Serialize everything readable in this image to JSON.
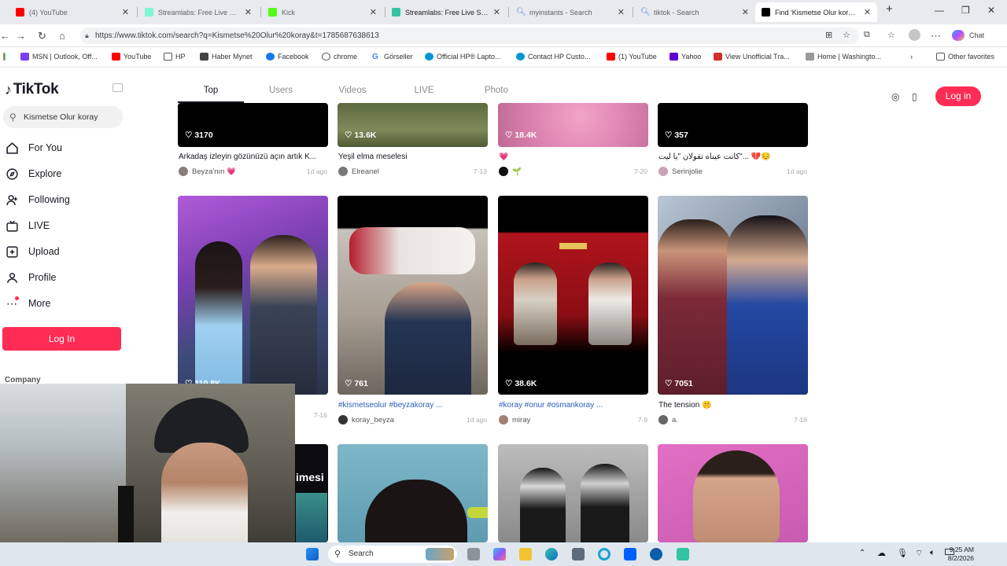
{
  "browser": {
    "tabs": [
      {
        "label": "(4) YouTube",
        "color": "#ff0000"
      },
      {
        "label": "Streamlabs: Free Live Stream",
        "color": "#80f5d2"
      },
      {
        "label": "Kick",
        "color": "#53fc18"
      },
      {
        "label": "Streamlabs: Free Live Stream",
        "color": "#31c3a2"
      },
      {
        "label": "myinstants - Search",
        "color": "#4285f4"
      },
      {
        "label": "tiktok - Search",
        "color": "#4285f4"
      },
      {
        "label": "Find 'Kismetse Olur koray' o",
        "color": "#000000"
      }
    ],
    "url": "https://www.tiktok.com/search?q=Kismetse%20Olur%20koray&t=1785687638613",
    "bookmarks": [
      "MSN | Outlook, Off...",
      "YouTube",
      "HP",
      "Haber Mynet",
      "Facebook",
      "chrome",
      "Görseller",
      "Official HP® Lapto...",
      "Contact HP Custo...",
      "(1) YouTube",
      "Yahoo",
      "View Unofficial Tra...",
      "Home | Washingto...",
      "Other favorites"
    ],
    "copilot_label": "Chat"
  },
  "sidebar": {
    "logo": "TikTok",
    "search_value": "Kismetse Olur koray",
    "nav": [
      "For You",
      "Explore",
      "Following",
      "LIVE",
      "Upload",
      "Profile",
      "More"
    ],
    "login": "Log In",
    "company": "Company"
  },
  "header": {
    "tabs": [
      "Top",
      "Users",
      "Videos",
      "LIVE",
      "Photo"
    ],
    "login": "Log in"
  },
  "row1": [
    {
      "likes": "3170",
      "caption": "Arkadaş izleyin gözünüzü açın artık K...",
      "author": "Beyza'nın 💗",
      "date": "1d ago"
    },
    {
      "likes": "13.6K",
      "caption": "Yeşil elma meselesi",
      "author": "Elreanel",
      "date": "7-13"
    },
    {
      "likes": "18.4K",
      "caption": "💗",
      "author": "🌱",
      "date": "7-20"
    },
    {
      "likes": "357",
      "caption": "كانت عيناه تقولان \"يا ليت\"... 💔😔",
      "author": "Serinjolie",
      "date": "1d ago"
    }
  ],
  "row2": [
    {
      "likes": "110.8K",
      "caption": "",
      "author": "",
      "date": "7-16"
    },
    {
      "likes": "761",
      "caption": "#kismetseolur #beyzakoray ...",
      "author": "koray_beyza",
      "date": "1d ago"
    },
    {
      "likes": "38.6K",
      "caption": "#koray #onur #osmankoray ...",
      "author": "miray",
      "date": "7-9"
    },
    {
      "likes": "7051",
      "caption": "The tension 🤫",
      "author": "a.",
      "date": "7-16"
    }
  ],
  "row3_overlay_text": "imesi",
  "taskbar": {
    "search": "Search",
    "time": "9:25 AM",
    "date": "8/2/2026"
  },
  "colors": {
    "accent": "#fe2c55",
    "link": "#2b5db9"
  }
}
